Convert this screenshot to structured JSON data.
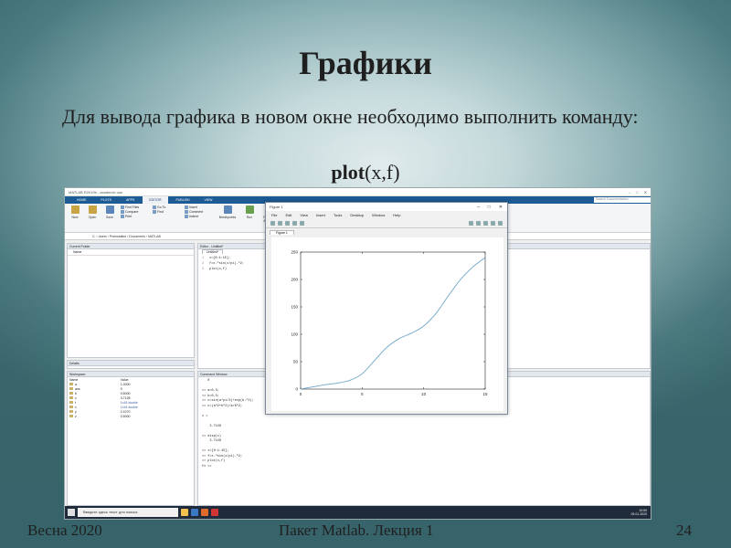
{
  "slide": {
    "title": "Графики",
    "text": "Для вывода графика в новом окне необходимо выполнить команду:",
    "command_bold": "plot",
    "command_args": "(x,f)",
    "footer_left": "Весна 2020",
    "footer_center": "Пакет Matlab. Лекция 1",
    "page_number": "24"
  },
  "matlab": {
    "window_title": "MATLAB R2019b - academic use",
    "tabs": [
      "HOME",
      "PLOTS",
      "APPS",
      "EDITOR",
      "PUBLISH",
      "VIEW"
    ],
    "active_tab": "EDITOR",
    "search_placeholder": "Search Documentation",
    "ribbon": {
      "new": "New",
      "open": "Open",
      "save": "Save",
      "find_files": "Find Files",
      "compare": "Compare",
      "print": "Print",
      "go_to": "Go To",
      "find": "Find",
      "insert": "Insert",
      "comment": "Comment",
      "indent": "Indent",
      "breakpoints": "Breakpoints",
      "run": "Run",
      "run_advance": "Run and Advance"
    },
    "path": "C: › Users › Preinstalled › Documents › MATLAB",
    "current_folder": {
      "title": "Current Folder",
      "column": "Name"
    },
    "details_title": "Details",
    "workspace": {
      "title": "Workspace",
      "headers": [
        "Name",
        "Value"
      ],
      "rows": [
        {
          "name": "a",
          "value": "1.0000",
          "blue": false
        },
        {
          "name": "ans",
          "value": "0",
          "blue": false
        },
        {
          "name": "b",
          "value": "0.5000",
          "blue": false
        },
        {
          "name": "c",
          "value": "3.7128",
          "blue": false
        },
        {
          "name": "f",
          "value": "1x16 double",
          "blue": true
        },
        {
          "name": "x",
          "value": "1x16 double",
          "blue": true
        },
        {
          "name": "y",
          "value": "2.4270",
          "blue": false
        },
        {
          "name": "z",
          "value": "0.5000",
          "blue": false
        }
      ]
    },
    "editor": {
      "title": "Editor - Untitled*",
      "tab": "Untitled*",
      "lines": [
        "x=[0:1:15];",
        "f=x.^sin(x/pi).^2;",
        "plot(x,f)"
      ]
    },
    "command_window": {
      "title": "Command Window",
      "lines": [
        "   0",
        "",
        ">> a=0.5;",
        ">> b=0.5;",
        ">> c=sin(a*pi/3)+exp(b.^2);",
        ">> c=(a^2+b^2)/a/b^2;",
        "",
        "c =",
        "",
        "    3.7128",
        "",
        ">> disp(c)",
        "    3.7128",
        "",
        ">> x=[0:1:15];",
        ">> f=x.^sin(x/pi).^2;",
        ">> plot(x,f)",
        "fx >>"
      ]
    },
    "taskbar": {
      "search": "Введите здесь текст для поиска",
      "time": "19:59",
      "date": "09.01.2020"
    }
  },
  "figure": {
    "title": "Figure 1",
    "menu": [
      "File",
      "Edit",
      "View",
      "Insert",
      "Tools",
      "Desktop",
      "Window",
      "Help"
    ],
    "tab": "Figure 1"
  },
  "chart_data": {
    "type": "line",
    "x": [
      0,
      1,
      2,
      3,
      4,
      5,
      6,
      7,
      8,
      9,
      10,
      11,
      12,
      13,
      14,
      15
    ],
    "series": [
      {
        "values": [
          0,
          4,
          8,
          11,
          16,
          28,
          52,
          76,
          92,
          102,
          115,
          138,
          170,
          200,
          223,
          240
        ],
        "color": "#6fa7c9"
      }
    ],
    "xlim": [
      0,
      15
    ],
    "ylim": [
      0,
      250
    ],
    "xticks": [
      0,
      5,
      10,
      15
    ],
    "yticks": [
      0,
      50,
      100,
      150,
      200,
      250
    ],
    "grid": false
  }
}
